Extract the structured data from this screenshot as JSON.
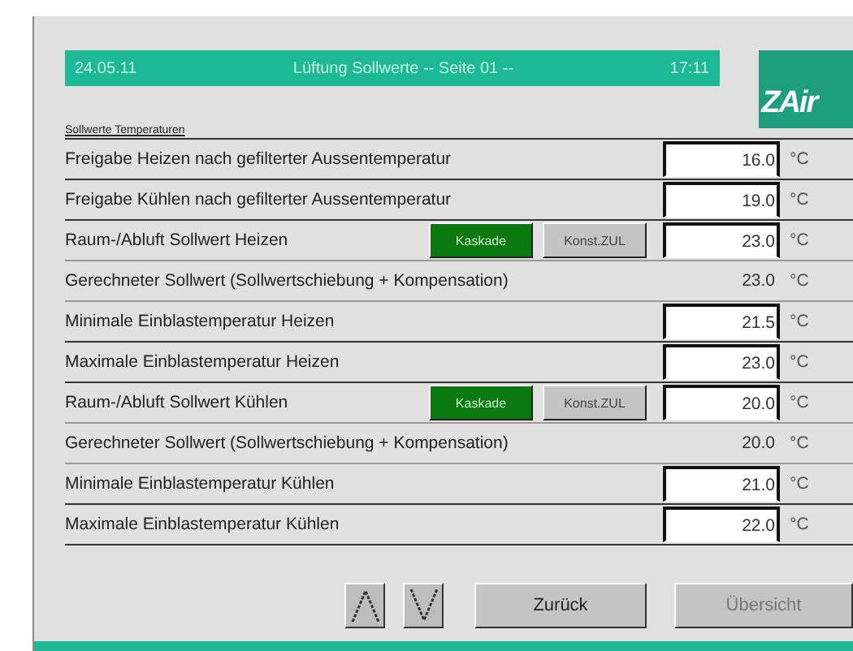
{
  "header": {
    "date": "24.05.11",
    "title": "Lüftung Sollwerte  -- Seite 01 --",
    "time": "17:11"
  },
  "logo": {
    "text": "ZAir"
  },
  "section": {
    "title": "Sollwerte Temperaturen"
  },
  "rows": [
    {
      "kind": "input",
      "label": "Freigabe Heizen nach gefilterter Aussentemperatur",
      "value": "16.0",
      "unit": "°C"
    },
    {
      "kind": "input",
      "label": "Freigabe Kühlen nach gefilterter Aussentemperatur",
      "value": "19.0",
      "unit": "°C"
    },
    {
      "kind": "mode",
      "label": "Raum-/Abluft Sollwert Heizen",
      "modes": [
        {
          "label": "Kaskade",
          "selected": true
        },
        {
          "label": "Konst.ZUL",
          "selected": false
        }
      ],
      "value": "23.0",
      "unit": "°C"
    },
    {
      "kind": "computed",
      "label": "Gerechneter Sollwert (Sollwertschiebung + Kompensation)",
      "value": "23.0",
      "unit": "°C"
    },
    {
      "kind": "input",
      "label": "Minimale Einblastemperatur Heizen",
      "value": "21.5",
      "unit": "°C"
    },
    {
      "kind": "input",
      "label": "Maximale Einblastemperatur Heizen",
      "value": "23.0",
      "unit": "°C"
    },
    {
      "kind": "mode",
      "label": "Raum-/Abluft Sollwert Kühlen",
      "modes": [
        {
          "label": "Kaskade",
          "selected": true
        },
        {
          "label": "Konst.ZUL",
          "selected": false
        }
      ],
      "value": "20.0",
      "unit": "°C"
    },
    {
      "kind": "computed",
      "label": "Gerechneter Sollwert (Sollwertschiebung + Kompensation)",
      "value": "20.0",
      "unit": "°C"
    },
    {
      "kind": "input",
      "label": "Minimale Einblastemperatur Kühlen",
      "value": "21.0",
      "unit": "°C"
    },
    {
      "kind": "input",
      "label": "Maximale Einblastemperatur Kühlen",
      "value": "22.0",
      "unit": "°C"
    }
  ],
  "footer": {
    "buttons": [
      {
        "kind": "up"
      },
      {
        "kind": "down"
      },
      {
        "kind": "text",
        "label": "Zurück",
        "disabled": false
      },
      {
        "kind": "text",
        "label": "Übersicht",
        "disabled": true
      }
    ]
  }
}
